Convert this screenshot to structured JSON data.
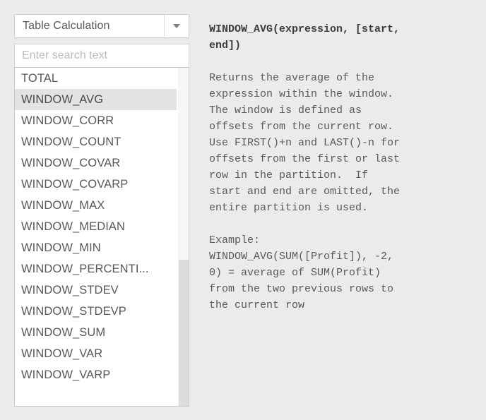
{
  "background_color": "#ebebeb",
  "dropdown": {
    "name": "calculation-type",
    "selected": "Table Calculation",
    "arrow_icon": "chevron-down-icon",
    "options": [
      "Table Calculation"
    ]
  },
  "search": {
    "value": "",
    "placeholder": "Enter search text"
  },
  "function_list": {
    "selected": "WINDOW_AVG",
    "selected_color": "#e3e3e3",
    "items": [
      "TOTAL",
      "WINDOW_AVG",
      "WINDOW_CORR",
      "WINDOW_COUNT",
      "WINDOW_COVAR",
      "WINDOW_COVARP",
      "WINDOW_MAX",
      "WINDOW_MEDIAN",
      "WINDOW_MIN",
      "WINDOW_PERCENTI...",
      "WINDOW_STDEV",
      "WINDOW_STDEVP",
      "WINDOW_SUM",
      "WINDOW_VAR",
      "WINDOW_VARP"
    ]
  },
  "scrollbar": {
    "orientation": "vertical",
    "thumb_position": "bottom"
  },
  "documentation": {
    "signature": "WINDOW_AVG(expression, [start,\nend])",
    "description": "Returns the average of the\nexpression within the window.\nThe window is defined as\noffsets from the current row.\nUse FIRST()+n and LAST()-n for\noffsets from the first or last\nrow in the partition.  If\nstart and end are omitted, the\nentire partition is used.",
    "example": "Example:\nWINDOW_AVG(SUM([Profit]), -2,\n0) = average of SUM(Profit)\nfrom the two previous rows to\nthe current row"
  }
}
